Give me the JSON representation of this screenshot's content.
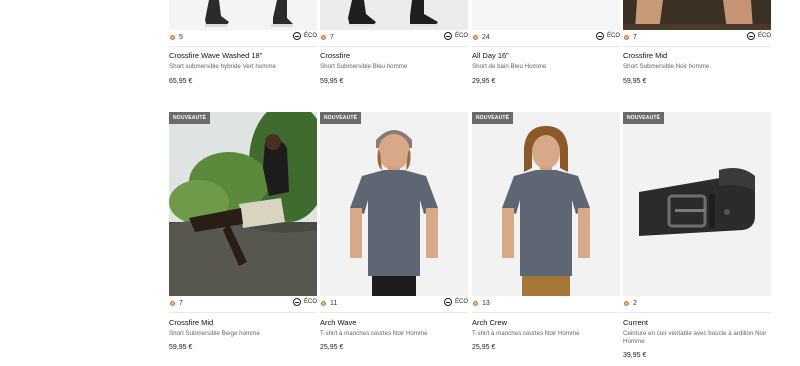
{
  "row1": [
    {
      "colors_count": "5",
      "eco": true,
      "title": "Crossfire Wave Washed 18\"",
      "subtitle": "Short submersible hybride Vert homme",
      "price": "65,95 €"
    },
    {
      "colors_count": "7",
      "eco": true,
      "title": "Crossfire",
      "subtitle": "Short Submersible Bleu homme",
      "price": "59,95 €"
    },
    {
      "colors_count": "24",
      "eco": true,
      "title": "All Day 16\"",
      "subtitle": "Short de bain Bleu Homme",
      "price": "29,95 €"
    },
    {
      "colors_count": "7",
      "eco": true,
      "title": "Crossfire Mid",
      "subtitle": "Short Submersible Noir homme",
      "price": "59,95 €"
    }
  ],
  "row2": [
    {
      "badge": "NOUVEAUTÉ",
      "colors_count": "7",
      "eco": true,
      "title": "Crossfire Mid",
      "subtitle": "Short Submersible Beige homme",
      "price": "59,95 €"
    },
    {
      "badge": "NOUVEAUTÉ",
      "colors_count": "11",
      "eco": true,
      "title": "Arch Wave",
      "subtitle": "T-shirt à manches courtes Noir Homme",
      "price": "25,95 €"
    },
    {
      "badge": "NOUVEAUTÉ",
      "colors_count": "13",
      "eco": false,
      "title": "Arch Crew",
      "subtitle": "T-shirt à manches courtes Noir Homme",
      "price": "25,95 €"
    },
    {
      "badge": "NOUVEAUTÉ",
      "colors_count": "2",
      "eco": false,
      "title": "Current",
      "subtitle": "Ceinture en cuir véritable avec boucle à ardillon Noir Homme",
      "price": "39,95 €"
    }
  ],
  "eco_label": "ÉCO",
  "colors": {
    "badge_bg": "#6b6b6b",
    "dot": "#e6b48e"
  }
}
